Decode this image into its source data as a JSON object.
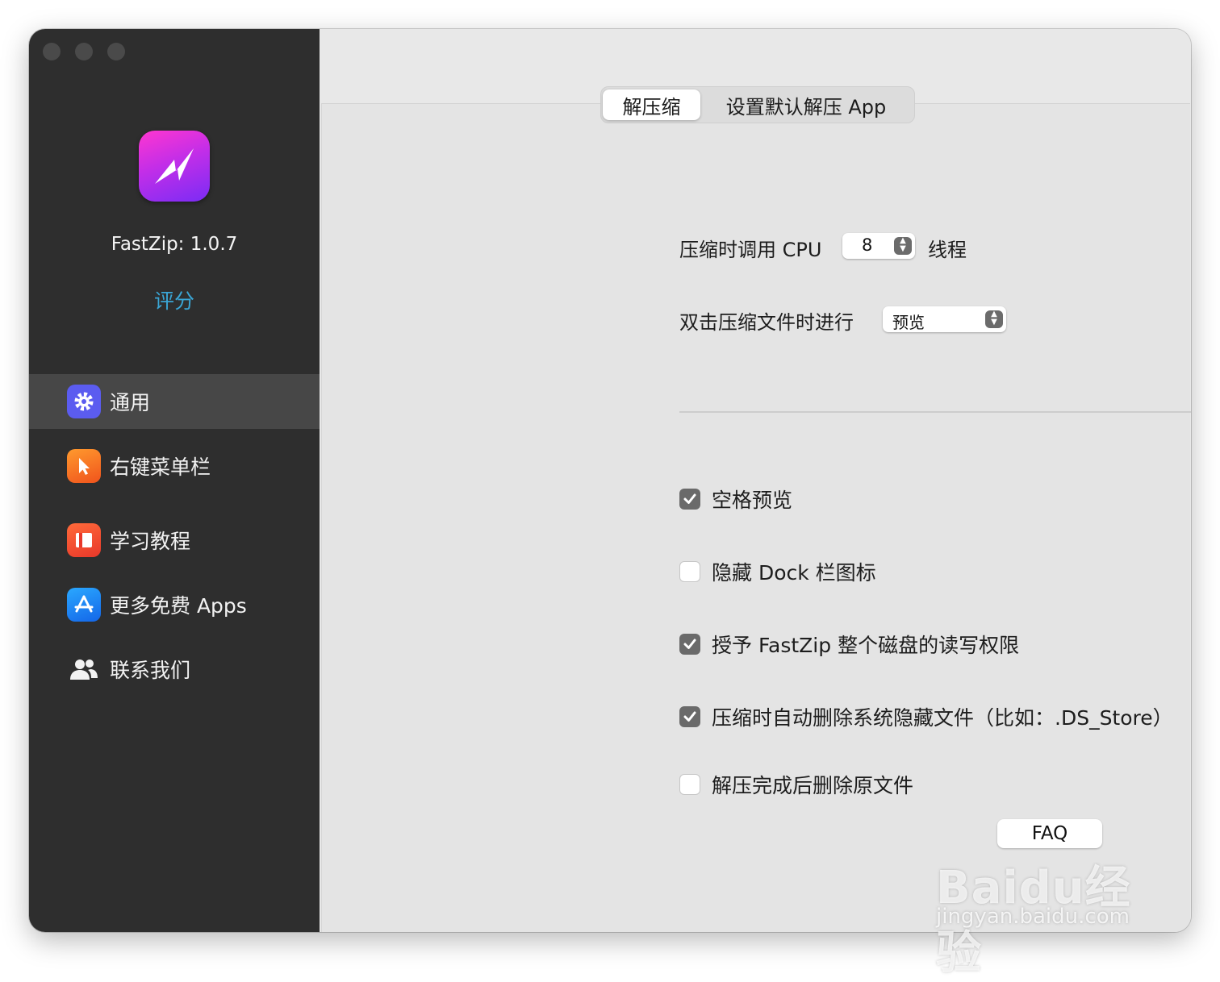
{
  "app": {
    "version_text": "FastZip: 1.0.7",
    "rate_label": "评分"
  },
  "sidebar": {
    "items": [
      {
        "label": "通用",
        "icon": "gear-icon",
        "color": "#5b5cf0",
        "active": true
      },
      {
        "label": "右键菜单栏",
        "icon": "cursor-icon",
        "color": "#f47a1f"
      },
      {
        "label": "学习教程",
        "icon": "book-icon",
        "color": "#f04a2c"
      },
      {
        "label": "更多免费 Apps",
        "icon": "app-store-icon",
        "color": "#1f8ef5"
      },
      {
        "label": "联系我们",
        "icon": "people-icon",
        "color": "#f2f2f2"
      }
    ]
  },
  "tabs": [
    {
      "label": "解压缩",
      "selected": true
    },
    {
      "label": "设置默认解压 App",
      "selected": false
    }
  ],
  "settings": {
    "cpu_label": "压缩时调用 CPU",
    "cpu_value": "8",
    "cpu_unit": "线程",
    "double_click_label": "双击压缩文件时进行",
    "double_click_value": "预览"
  },
  "checkboxes": [
    {
      "label": "空格预览",
      "checked": true
    },
    {
      "label": "隐藏 Dock 栏图标",
      "checked": false
    },
    {
      "label": "授予 FastZip 整个磁盘的读写权限",
      "checked": true
    },
    {
      "label": "压缩时自动删除系统隐藏文件（比如：.DS_Store）",
      "checked": true
    },
    {
      "label": "解压完成后删除原文件",
      "checked": false
    }
  ],
  "faq_label": "FAQ",
  "watermark": {
    "logo": "Baidu经验",
    "url": "jingyan.baidu.com"
  }
}
